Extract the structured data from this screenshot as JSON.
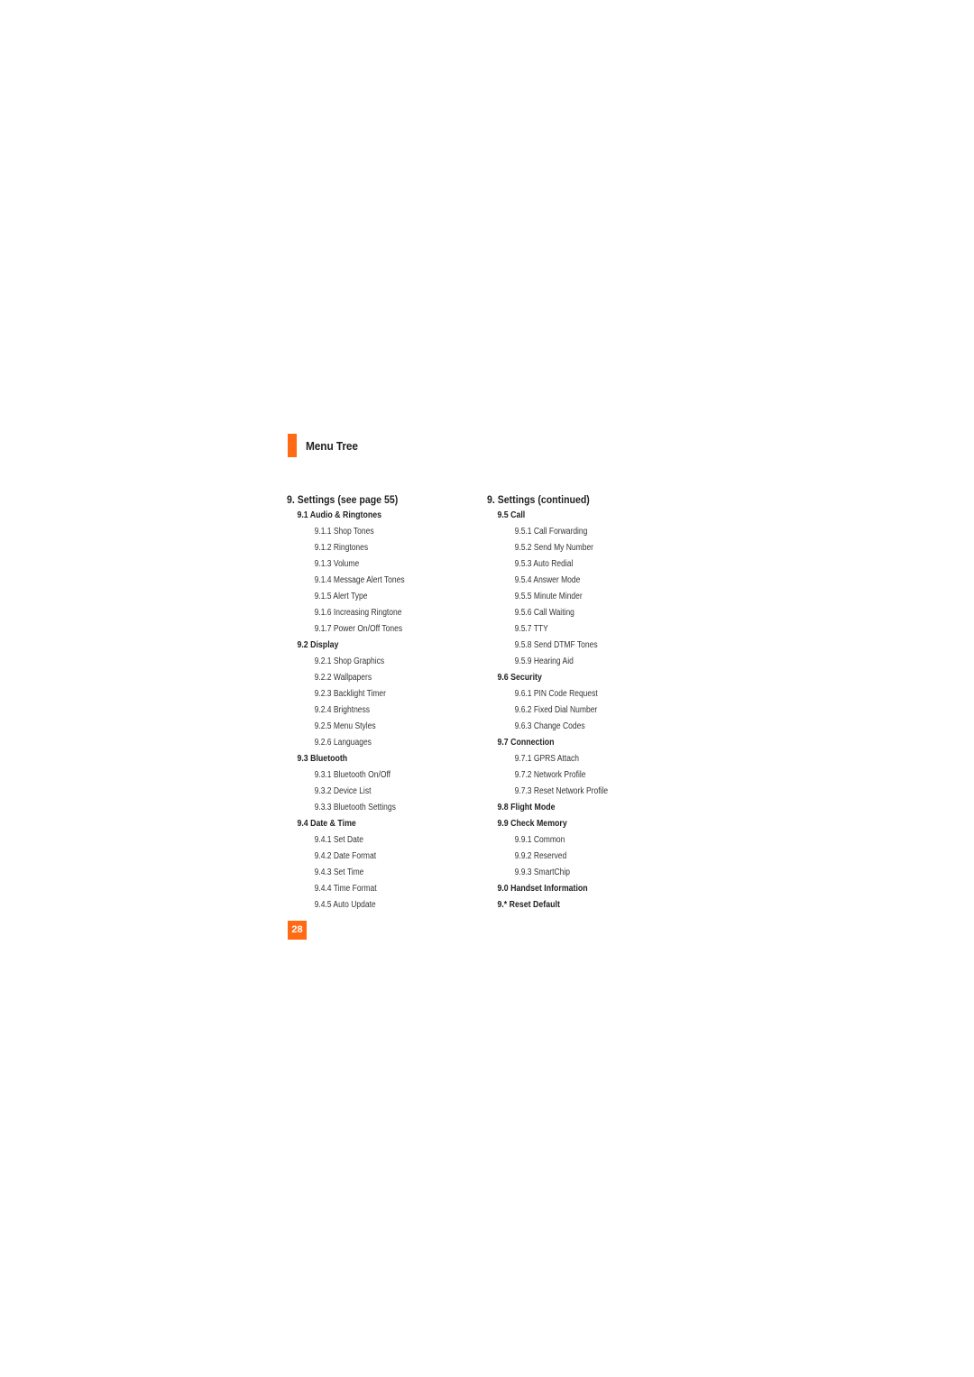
{
  "header": {
    "title": "Menu Tree",
    "accent_color": "#ff6a13"
  },
  "left_column": {
    "title": "9. Settings (see page 55)",
    "sections": [
      {
        "label": "9.1 Audio & Ringtones",
        "items": [
          "9.1.1 Shop Tones",
          "9.1.2 Ringtones",
          "9.1.3 Volume",
          "9.1.4 Message Alert Tones",
          "9.1.5 Alert Type",
          "9.1.6 Increasing Ringtone",
          "9.1.7 Power On/Off Tones"
        ]
      },
      {
        "label": "9.2 Display",
        "items": [
          "9.2.1 Shop Graphics",
          "9.2.2 Wallpapers",
          "9.2.3 Backlight Timer",
          "9.2.4 Brightness",
          "9.2.5 Menu Styles",
          "9.2.6 Languages"
        ]
      },
      {
        "label": "9.3 Bluetooth",
        "items": [
          "9.3.1 Bluetooth On/Off",
          "9.3.2 Device List",
          "9.3.3 Bluetooth Settings"
        ]
      },
      {
        "label": "9.4 Date & Time",
        "items": [
          "9.4.1 Set Date",
          "9.4.2 Date Format",
          "9.4.3 Set Time",
          "9.4.4 Time Format",
          "9.4.5 Auto Update"
        ]
      }
    ]
  },
  "right_column": {
    "title": "9. Settings (continued)",
    "sections": [
      {
        "label": "9.5 Call",
        "items": [
          "9.5.1 Call Forwarding",
          "9.5.2 Send My Number",
          "9.5.3 Auto Redial",
          "9.5.4 Answer Mode",
          "9.5.5 Minute Minder",
          "9.5.6 Call Waiting",
          "9.5.7 TTY",
          "9.5.8 Send DTMF Tones",
          "9.5.9 Hearing Aid"
        ]
      },
      {
        "label": "9.6 Security",
        "items": [
          "9.6.1 PIN Code Request",
          "9.6.2 Fixed Dial Number",
          "9.6.3 Change Codes"
        ]
      },
      {
        "label": "9.7 Connection",
        "items": [
          "9.7.1 GPRS Attach",
          "9.7.2 Network Profile",
          "9.7.3 Reset Network Profile"
        ]
      },
      {
        "label": "9.8 Flight Mode",
        "items": []
      },
      {
        "label": "9.9 Check Memory",
        "items": [
          "9.9.1 Common",
          "9.9.2 Reserved",
          "9.9.3 SmartChip"
        ]
      },
      {
        "label": "9.0 Handset Information",
        "items": []
      },
      {
        "label": "9.* Reset Default",
        "items": []
      }
    ]
  },
  "footer": {
    "page_number": "28"
  }
}
